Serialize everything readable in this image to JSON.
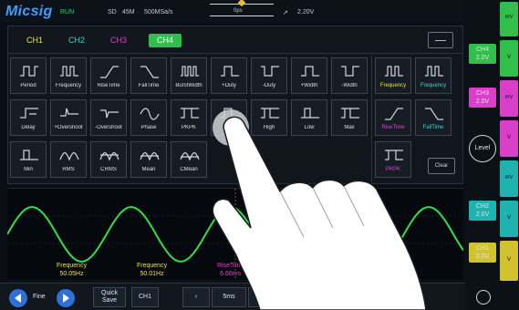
{
  "header": {
    "logo": "Micsig",
    "run_status": "RUN",
    "sample_depth": "SD",
    "memory": "45M",
    "sample_rate": "500MSa/s",
    "trigger_position": "0ps",
    "trigger_info": "2.20V"
  },
  "channel_tabs": [
    {
      "label": "CH1",
      "color": "#f2e24a",
      "active": false
    },
    {
      "label": "CH2",
      "color": "#41d6d0",
      "active": false
    },
    {
      "label": "CH3",
      "color": "#e53fd6",
      "active": false
    },
    {
      "label": "CH4",
      "color": "#ffffff",
      "active": true
    }
  ],
  "measurements": [
    "Period",
    "Frequency",
    "RiseTime",
    "FallTime",
    "BurstWidth",
    "+Duty",
    "-Duty",
    "+Width",
    "-Width",
    "Delay",
    "+Overshoot",
    "-Overshoot",
    "Phase",
    "PKPK",
    "",
    "High",
    "Low",
    "Max",
    "Min",
    "RMS",
    "CRMS",
    "Mean",
    "CMean"
  ],
  "selected_measurements": [
    {
      "label": "Frequency",
      "color": "#f2e24a"
    },
    {
      "label": "Frequency",
      "color": "#41d6d0"
    },
    {
      "label": "RiseTime",
      "color": "#e53fd6"
    },
    {
      "label": "FallTime",
      "color": "#41d6d0"
    },
    {
      "label": "PKPK",
      "color": "#e53fd6"
    }
  ],
  "clear_label": "Clear",
  "readouts": [
    {
      "name": "Frequency",
      "value": "50.05Hz",
      "color": "#f2e24a"
    },
    {
      "name": "Frequency",
      "value": "50.01Hz",
      "color": "#f2e24a"
    },
    {
      "name": "RiseTime",
      "value": "6.66ms",
      "color": "#e53fd6"
    }
  ],
  "bottom": {
    "fine_label": "Fine",
    "quick_save_label": "Quick Save",
    "ch_label": "CH1",
    "timebase_label": "5ms",
    "unit_label": "ms"
  },
  "sidebar": {
    "level_label": "Level",
    "channels": [
      {
        "label": "CH4",
        "volts": "2.0V",
        "color": "#2fbf4a"
      },
      {
        "label": "CH3",
        "volts": "2.0V",
        "color": "#d93fc8"
      },
      {
        "label": "CH2",
        "volts": "2.0V",
        "color": "#1fb3b0"
      },
      {
        "label": "CH1",
        "volts": "2.0V",
        "color": "#d2c22e"
      }
    ],
    "strip_unit": "mV",
    "strip_unit_v": "V"
  }
}
